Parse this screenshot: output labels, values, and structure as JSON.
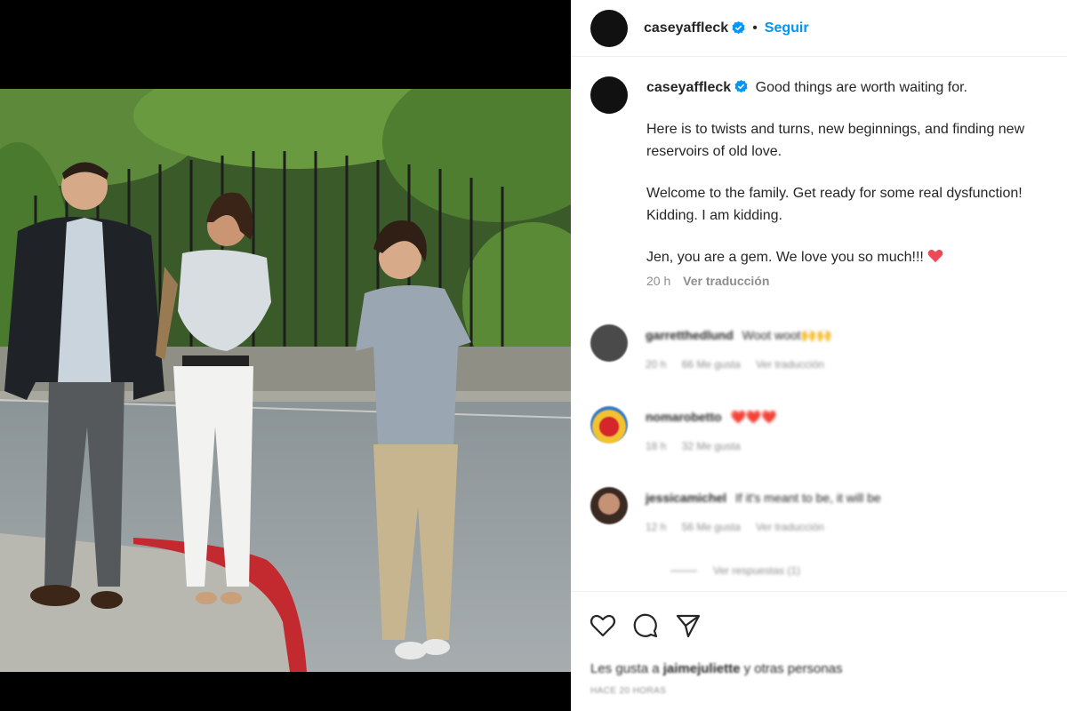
{
  "post": {
    "username": "caseyaffleck",
    "follow_label": "Seguir",
    "separator": "•",
    "caption_lines": [
      "Good things are worth waiting for.",
      "Here is to twists and turns, new beginnings, and finding new",
      "reservoirs of old love.",
      "Welcome to the family. Get ready for some real dysfunction!",
      "Kidding. I am kidding.",
      "Jen, you are a gem. We love you so much!!!"
    ],
    "time": "20 h",
    "translate_label": "Ver traducción"
  },
  "comments": [
    {
      "user": "garretthedlund",
      "text": "Woot woot🙌🙌",
      "time": "20 h",
      "likes": "66 Me gusta",
      "translate": "Ver traducción"
    },
    {
      "user": "nomarobetto",
      "text": "❤️❤️❤️",
      "time": "18 h",
      "likes": "32 Me gusta",
      "translate": ""
    },
    {
      "user": "jessicamichel",
      "text": "If it's meant to be, it will be",
      "time": "12 h",
      "likes": "56 Me gusta",
      "translate": "Ver traducción"
    }
  ],
  "replies_label": "Ver respuestas (1)",
  "likes": {
    "prefix": "Les gusta a",
    "user": "jaimejuliette",
    "suffix": "y otras personas"
  },
  "time_ago": "HACE 20 HORAS",
  "colors": {
    "accent": "#0095f6",
    "verified": "#0095f6",
    "heart": "#ed4956",
    "text": "#262626",
    "muted": "#8e8e8e"
  },
  "icons": [
    "verified-badge-icon",
    "heart-icon",
    "comment-icon",
    "share-icon"
  ]
}
